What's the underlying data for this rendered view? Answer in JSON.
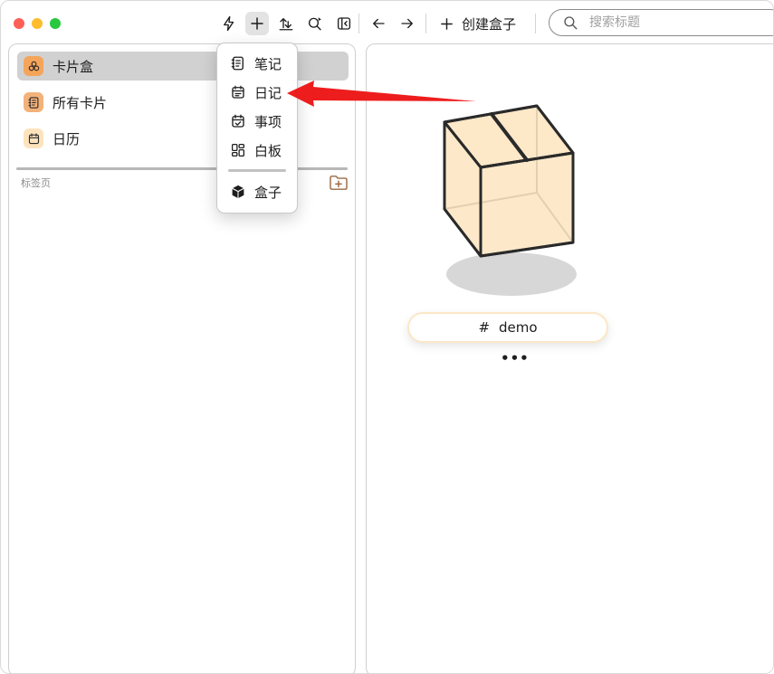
{
  "toolbar": {
    "icons": [
      "flash-icon",
      "plus-icon",
      "import-export-icon",
      "search-refresh-icon",
      "sidebar-toggle-icon",
      "arrow-left-icon",
      "arrow-right-icon"
    ],
    "create_box_label": "创建盒子",
    "search_placeholder": "搜索标题"
  },
  "sidebar": {
    "items": [
      {
        "label": "卡片盒",
        "icon": "cardbox-icon",
        "icon_bg": "#f5a55a",
        "selected": true
      },
      {
        "label": "所有卡片",
        "icon": "notebook-icon",
        "icon_bg": "#f2b27a",
        "selected": false
      },
      {
        "label": "日历",
        "icon": "calendar-icon",
        "icon_bg": "#fde3bd",
        "selected": false
      }
    ],
    "tags_label": "标签页"
  },
  "menu": {
    "items": [
      {
        "label": "笔记",
        "icon": "notebook-icon"
      },
      {
        "label": "日记",
        "icon": "calendar-list-icon"
      },
      {
        "label": "事项",
        "icon": "calendar-check-icon"
      },
      {
        "label": "白板",
        "icon": "whiteboard-grid-icon"
      },
      {
        "label": "盒子",
        "icon": "cube-icon"
      }
    ]
  },
  "main": {
    "tag_hash": "#",
    "tag_name": "demo",
    "more_label": "•••"
  },
  "colors": {
    "annotation_arrow": "#ee1d1d",
    "box_fill": "#fde8c8",
    "accent": "#f5a55a"
  }
}
